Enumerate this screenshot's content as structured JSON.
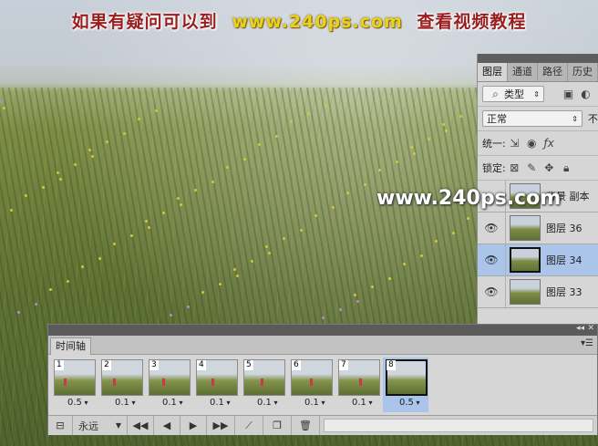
{
  "caption": {
    "prefix": "如果有疑问可以到",
    "url": "www.240ps.com",
    "suffix": "查看视频教程"
  },
  "watermark": "www.240ps.com",
  "layers_panel": {
    "tabs": [
      "图层",
      "通道",
      "路径",
      "历史"
    ],
    "filter_kind": "类型",
    "blend_mode": "正常",
    "opacity_label_cut": "不",
    "unify_label": "统一:",
    "lock_label": "锁定:",
    "layers": [
      {
        "name": "背景 副本",
        "visible": false,
        "selected": false
      },
      {
        "name": "图层 36",
        "visible": true,
        "selected": false
      },
      {
        "name": "图层 34",
        "visible": true,
        "selected": true
      },
      {
        "name": "图层 33",
        "visible": true,
        "selected": false
      }
    ]
  },
  "timeline": {
    "tab": "时间轴",
    "loop": "永远",
    "frames": [
      {
        "num": "1",
        "delay": "0.5"
      },
      {
        "num": "2",
        "delay": "0.1"
      },
      {
        "num": "3",
        "delay": "0.1"
      },
      {
        "num": "4",
        "delay": "0.1"
      },
      {
        "num": "5",
        "delay": "0.1"
      },
      {
        "num": "6",
        "delay": "0.1"
      },
      {
        "num": "7",
        "delay": "0.1"
      },
      {
        "num": "8",
        "delay": "0.5"
      }
    ],
    "selected_frame": "8"
  },
  "colors": {
    "selection": "#aac4ea",
    "panel": "#d6d6d6",
    "caption_red": "#9b1e1e",
    "caption_yellow": "#e8d21f"
  }
}
